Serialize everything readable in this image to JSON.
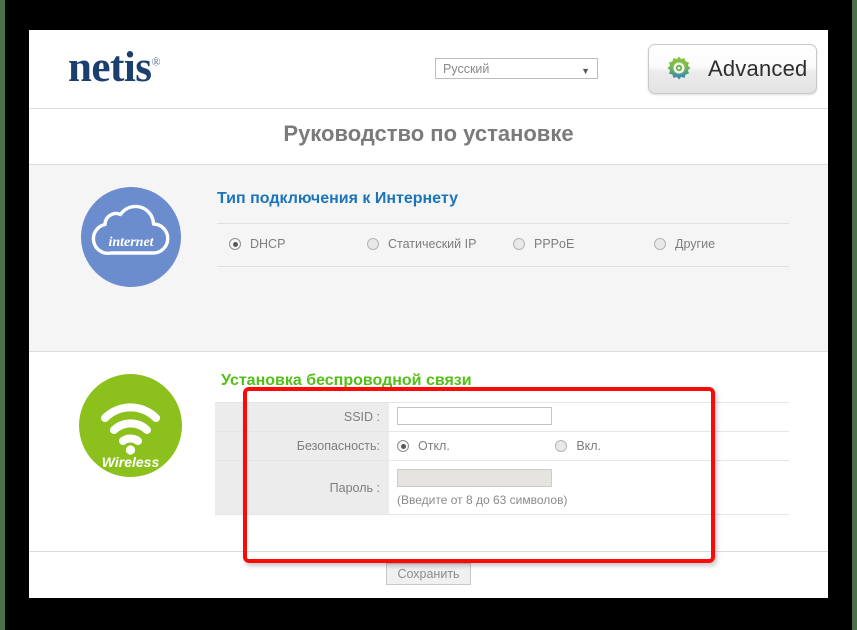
{
  "header": {
    "logo_text": "netis",
    "logo_registered": "®",
    "language": {
      "selected": "Русский",
      "caret": "▼"
    },
    "advanced_button": {
      "label": "Advanced",
      "icon": "gear-icon"
    }
  },
  "page_title": "Руководство по установке",
  "internet_section": {
    "icon_label": "internet",
    "icon_color": "#6c8dcd",
    "heading": "Тип подключения к Интернету",
    "heading_color": "#1b75bb",
    "connection_types": [
      {
        "label": "DHCP",
        "selected": true
      },
      {
        "label": "Статический IP",
        "selected": false
      },
      {
        "label": "PPPoE",
        "selected": false
      },
      {
        "label": "Другие",
        "selected": false
      }
    ]
  },
  "wireless_section": {
    "icon_label": "Wireless",
    "icon_color": "#8cc11d",
    "heading": "Установка беспроводной связи",
    "heading_color": "#53c016",
    "fields": {
      "ssid_label": "SSID :",
      "ssid_value": "",
      "security_label": "Безопасность:",
      "security_options": [
        {
          "label": "Откл.",
          "selected": true
        },
        {
          "label": "Вкл.",
          "selected": false
        }
      ],
      "password_label": "Пароль :",
      "password_value": "",
      "password_hint": "(Введите от 8 до 63 символов)"
    },
    "highlight_color": "#fa0b07"
  },
  "footer": {
    "save_label": "Сохранить"
  }
}
